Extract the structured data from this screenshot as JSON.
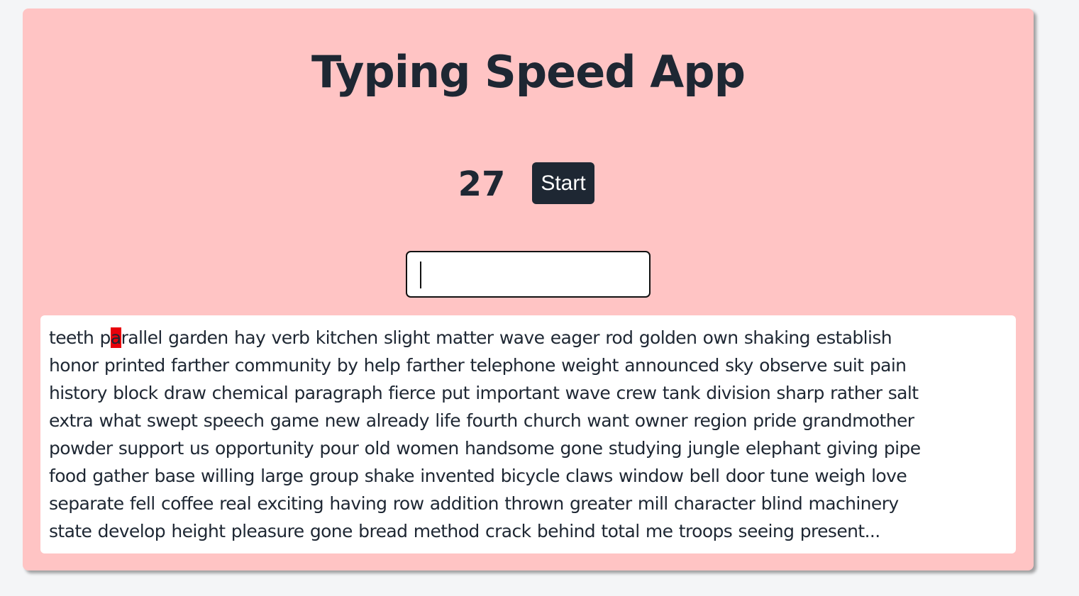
{
  "app": {
    "title": "Typing Speed App"
  },
  "controls": {
    "timer_value": "27",
    "start_label": "Start"
  },
  "input": {
    "value": "",
    "placeholder": ""
  },
  "text": {
    "before_current": "teeth p",
    "current_char": "a",
    "after_current": "rallel garden hay verb kitchen slight matter wave eager rod golden own shaking establish\nhonor printed farther community by help farther telephone weight announced sky observe suit pain\nhistory block draw chemical paragraph fierce put important wave crew tank division sharp rather salt\nextra what swept speech game new already life fourth church want owner region pride grandmother\npowder support us opportunity pour old women handsome gone studying jungle elephant giving pipe\nfood gather base willing large group shake invented bicycle claws window bell door tune weigh love\nseparate fell coffee real exciting having row addition thrown greater mill character blind machinery\nstate develop height pleasure gone bread method crack behind total me troops seeing present..."
  },
  "colors": {
    "card_background": "#ffc4c4",
    "text_dark": "#1e2733",
    "highlight": "#e8000b",
    "page_background": "#f4f5f7"
  }
}
